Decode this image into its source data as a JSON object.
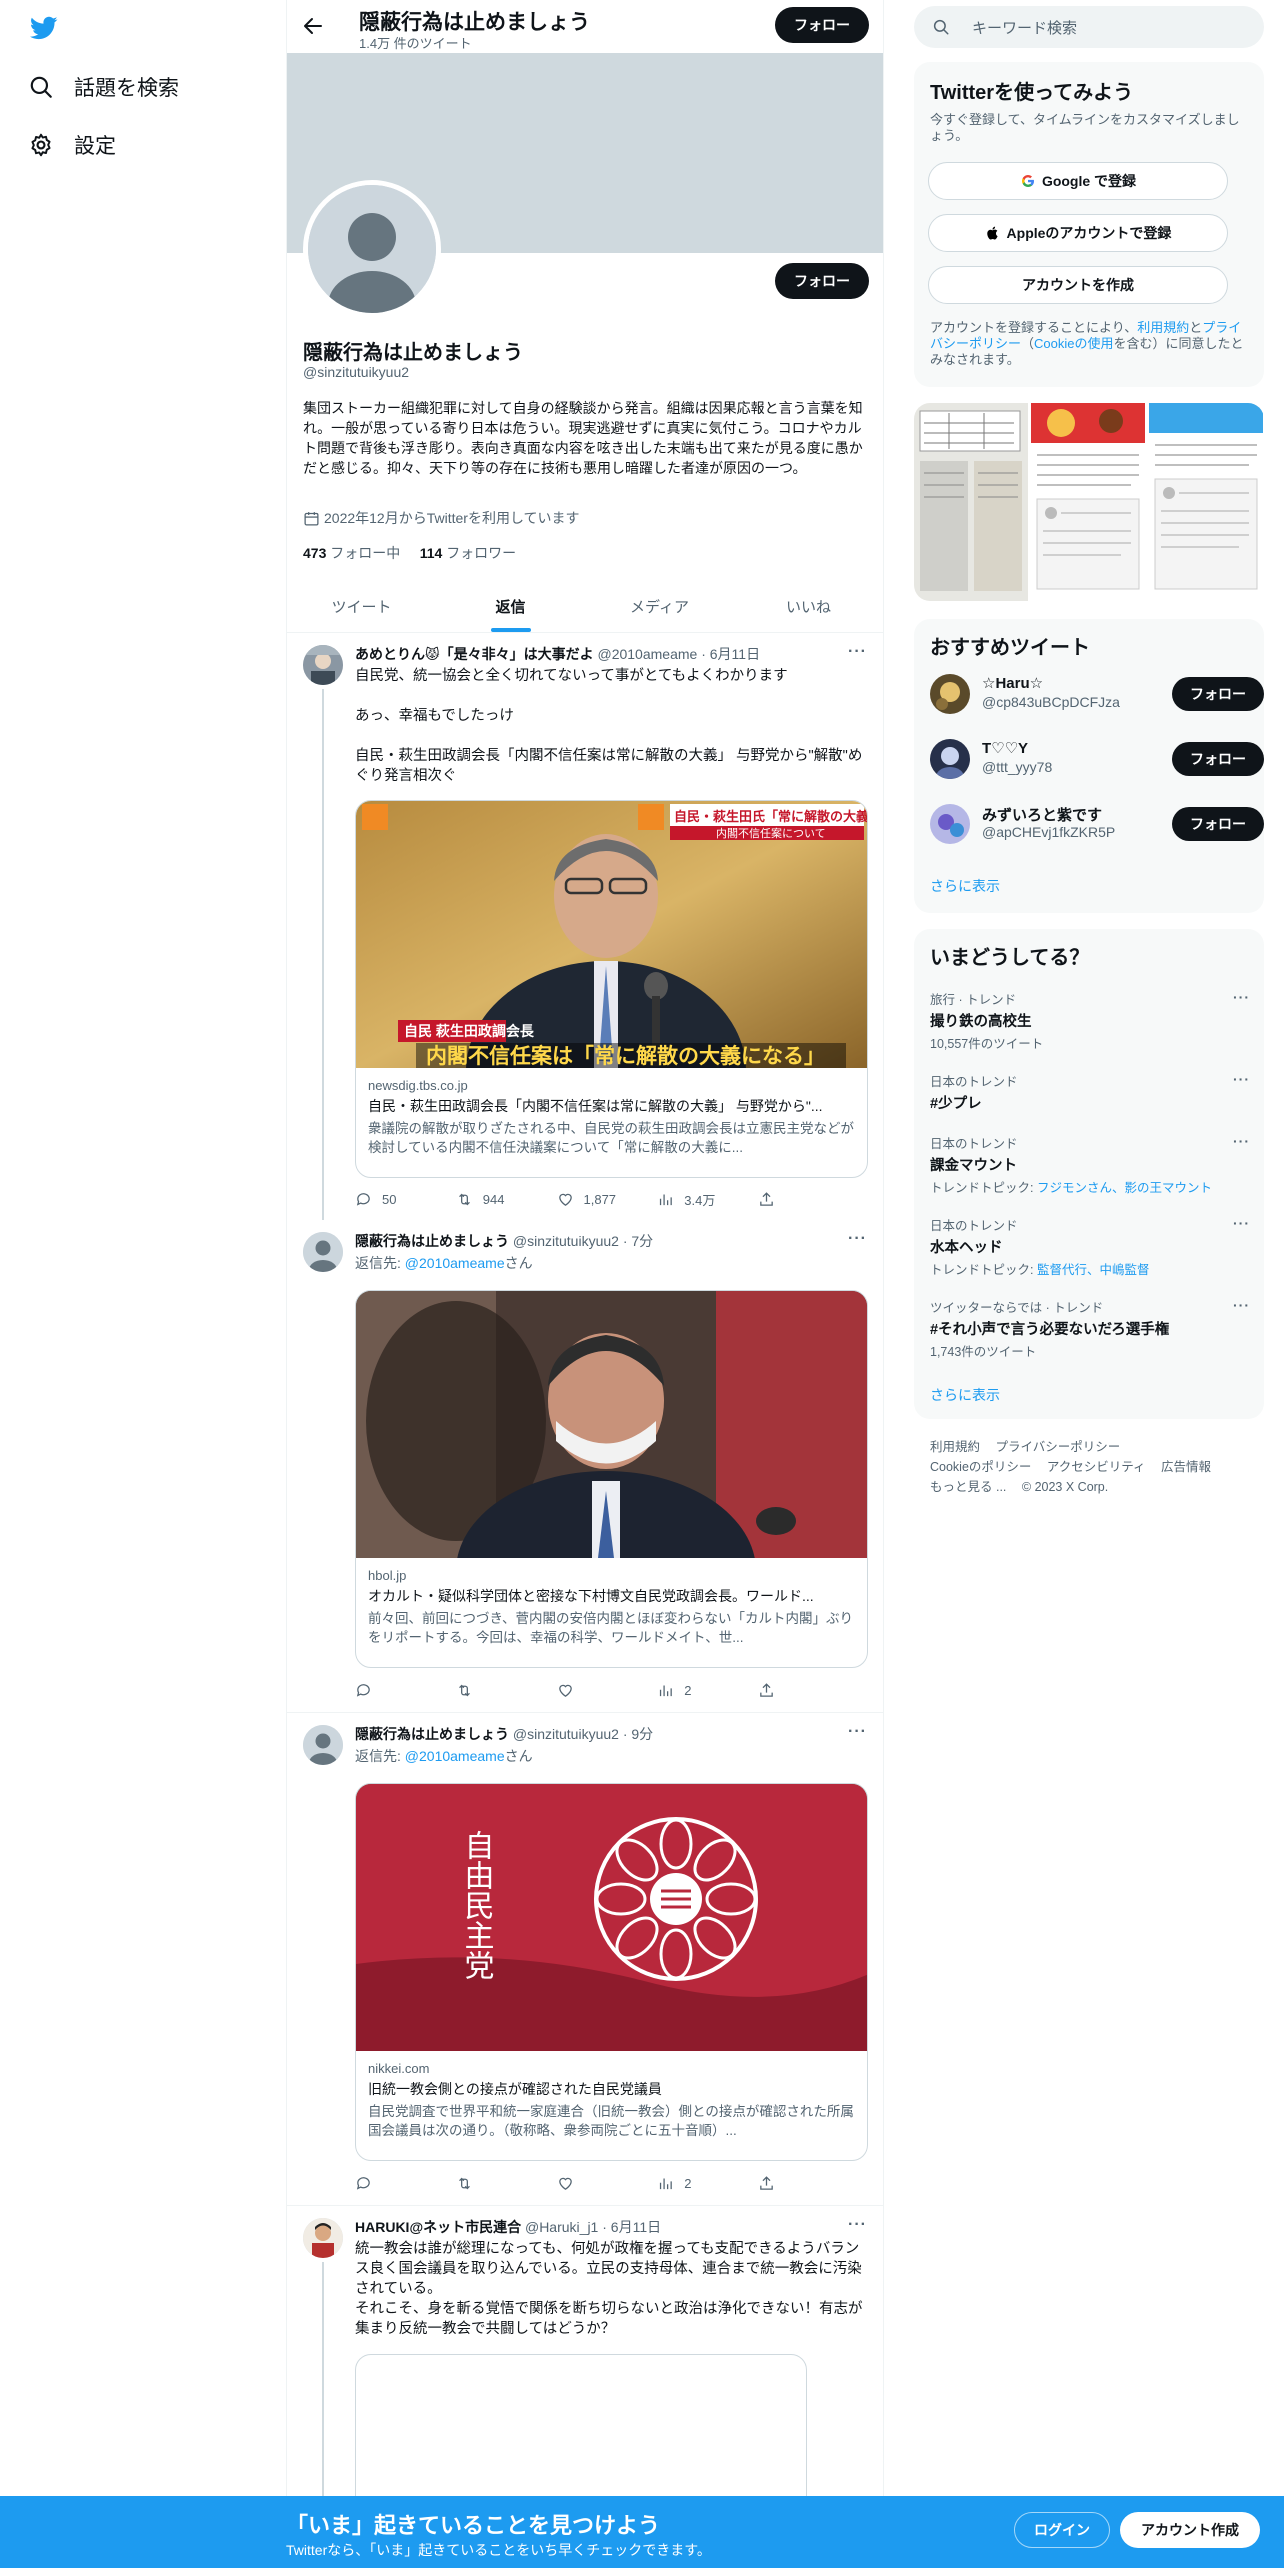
{
  "nav": {
    "explore_label": "話題を検索",
    "settings_label": "設定"
  },
  "header": {
    "title": "隠蔽行為は止めましょう",
    "tweet_count": "1.4万 件のツイート",
    "follow_label": "フォロー"
  },
  "profile": {
    "name": "隠蔽行為は止めましょう",
    "handle": "@sinzitutuikyuu2",
    "bio": "集団ストーカー組織犯罪に対して自身の経験談から発言。組織は因果応報と言う言葉を知れ。一般が思っている寄り日本は危うい。現実逃避せずに真実に気付こう。コロナやカルト問題で背後も浮き彫り。表向き真面な内容を呟き出した末端も出て来たが見る度に愚かだと感じる。抑々、天下り等の存在に技術も悪用し暗躍した者達が原因の一つ。",
    "joined": "2022年12月からTwitterを利用しています",
    "following_count": "473",
    "following_label": "フォロー中",
    "followers_count": "114",
    "followers_label": "フォロワー",
    "follow_label": "フォロー"
  },
  "tabs": [
    {
      "label": "ツイート"
    },
    {
      "label": "返信"
    },
    {
      "label": "メディア"
    },
    {
      "label": "いいね"
    }
  ],
  "tweets": [
    {
      "name": "あめとりん😾「是々非々」は大事だよ",
      "handle": "@2010ameame",
      "time": "6月11日",
      "body": "自民党、統一協会と全く切れてないって事がとてもよくわかります\n\nあっ、幸福もでしたっけ\n\n自民・萩生田政調会長「内閣不信任案は常に解散の大義」 与野党から\"解散\"めぐり発言相次ぐ",
      "card": {
        "domain": "newsdig.tbs.co.jp",
        "title": "自民・萩生田政調会長「内閣不信任案は常に解散の大義」 与野党から\"...",
        "desc": "衆議院の解散が取りざたされる中、自民党の萩生田政調会長は立憲民主党などが検討している内閣不信任決議案について「常に解散の大義に...",
        "image_caption_tag": "自民 萩生田政調会長",
        "image_caption": "内閣不信任案は「常に解散の大義になる」",
        "image_top_right": "自民・萩生田氏「常に解散の大義になる」",
        "image_top_right2": "内閣不信任案について"
      },
      "replies": "50",
      "retweets": "944",
      "likes": "1,877",
      "views": "3.4万"
    },
    {
      "name": "隠蔽行為は止めましょう",
      "handle": "@sinzitutuikyuu2",
      "time": "7分",
      "reply_to_prefix": "返信先: ",
      "reply_to": "@2010ameame",
      "reply_to_suffix": "さん",
      "card": {
        "domain": "hbol.jp",
        "title": "オカルト・疑似科学団体と密接な下村博文自民党政調会長。ワールド...",
        "desc": "前々回、前回につづき、菅内閣の安倍内閣とほぼ変わらない「カルト内閣」ぶりをリポートする。今回は、幸福の科学、ワールドメイト、世..."
      },
      "views": "2"
    },
    {
      "name": "隠蔽行為は止めましょう",
      "handle": "@sinzitutuikyuu2",
      "time": "9分",
      "reply_to_prefix": "返信先: ",
      "reply_to": "@2010ameame",
      "reply_to_suffix": "さん",
      "card": {
        "domain": "nikkei.com",
        "title": "旧統一教会側との接点が確認された自民党議員",
        "desc": "自民党調査で世界平和統一家庭連合（旧統一教会）側との接点が確認された所属国会議員は次の通り。（敬称略、衆参両院ごとに五十音順）...",
        "flag_text": "自由民主党"
      },
      "views": "2"
    },
    {
      "name": "HARUKI@ネット市民連合",
      "handle": "@Haruki_j1",
      "time": "6月11日",
      "body": "統一教会は誰が総理になっても、何処が政権を握っても支配できるようバランス良く国会議員を取り込んでいる。立民の支持母体、連合まで統一教会に汚染されている。\nそれこそ、身を斬る覚悟で関係を断ち切らないと政治は浄化できない！有志が集まり反統一教会で共闘してはどうか？"
    }
  ],
  "right": {
    "search_placeholder": "キーワード検索",
    "signup_panel": {
      "title": "Twitterを使ってみよう",
      "subtitle": "今すぐ登録して、タイムラインをカスタマイズしましょう。",
      "google_label": "Google で登録",
      "apple_label": "Appleのアカウントで登録",
      "create_label": "アカウントを作成",
      "terms_prefix": "アカウントを登録することにより、",
      "terms_link": "利用規約",
      "terms_mid": "と",
      "privacy_link": "プライバシーポリシー",
      "cookie_open": "（",
      "cookie_link": "Cookieの使用",
      "cookie_suffix": "を含む）に同意したとみなされます。"
    },
    "recommend": {
      "title": "おすすめツイート",
      "follow_label": "フォロー",
      "users": [
        {
          "name": "☆Haru☆",
          "handle": "@cp843uBCpDCFJza"
        },
        {
          "name": "T♡♡Y",
          "handle": "@ttt_yyy78"
        },
        {
          "name": "みずいろと紫です",
          "handle": "@apCHEvj1fkZKR5P"
        }
      ],
      "show_more": "さらに表示"
    },
    "trends": {
      "title": "いまどうしてる？",
      "items": [
        {
          "context": "旅行 · トレンド",
          "title": "撮り鉄の高校生",
          "meta": "10,557件のツイート"
        },
        {
          "context": "日本のトレンド",
          "title": "#少プレ",
          "meta": ""
        },
        {
          "context": "日本のトレンド",
          "title": "課金マウント",
          "meta_prefix": "トレンドトピック: ",
          "meta_links": "フジモンさん、影の王マウント"
        },
        {
          "context": "日本のトレンド",
          "title": "水本ヘッド",
          "meta_prefix": "トレンドトピック: ",
          "meta_links": "監督代行、中嶋監督"
        },
        {
          "context": "ツイッターならでは · トレンド",
          "title": "#それ小声で言う必要ないだろ選手権",
          "meta": "1,743件のツイート"
        }
      ],
      "show_more": "さらに表示"
    },
    "footer": {
      "line1": [
        "利用規約",
        "プライバシーポリシー"
      ],
      "line2": [
        "Cookieのポリシー",
        "アクセシビリティ",
        "広告情報"
      ],
      "more": "もっと見る ...",
      "copyright": "© 2023 X Corp."
    }
  },
  "bottom_bar": {
    "title": "「いま」起きていることを見つけよう",
    "subtitle": "Twitterなら、「いま」起きていることをいち早くチェックできます。",
    "login_label": "ログイン",
    "signup_label": "アカウント作成"
  },
  "colors": {
    "accent": "#1d9bf0",
    "text": "#0f1419",
    "muted": "#536471",
    "banner": "#cfd9de"
  }
}
